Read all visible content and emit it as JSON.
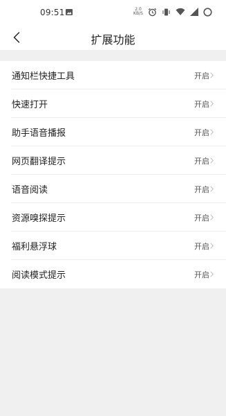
{
  "status_bar": {
    "time": "09:51",
    "net_speed_value": "2.0",
    "net_speed_unit": "KB/S",
    "icons": [
      "image-notification-icon",
      "alarm-icon",
      "vibrate-icon",
      "wifi-icon",
      "cellular-signal-icon",
      "battery-icon"
    ]
  },
  "header": {
    "title": "扩展功能",
    "back_icon": "chevron-left-icon"
  },
  "settings": {
    "items": [
      {
        "label": "通知栏快捷工具",
        "value": "开启"
      },
      {
        "label": "快速打开",
        "value": "开启"
      },
      {
        "label": "助手语音播报",
        "value": "开启"
      },
      {
        "label": "网页翻译提示",
        "value": "开启"
      },
      {
        "label": "语音阅读",
        "value": "开启"
      },
      {
        "label": "资源嗅探提示",
        "value": "开启"
      },
      {
        "label": "福利悬浮球",
        "value": "开启"
      },
      {
        "label": "阅读模式提示",
        "value": "开启"
      }
    ]
  },
  "colors": {
    "background": "#f0f0f0",
    "surface": "#ffffff",
    "text_primary": "#222222",
    "text_secondary": "#555555",
    "divider": "#ececec"
  }
}
